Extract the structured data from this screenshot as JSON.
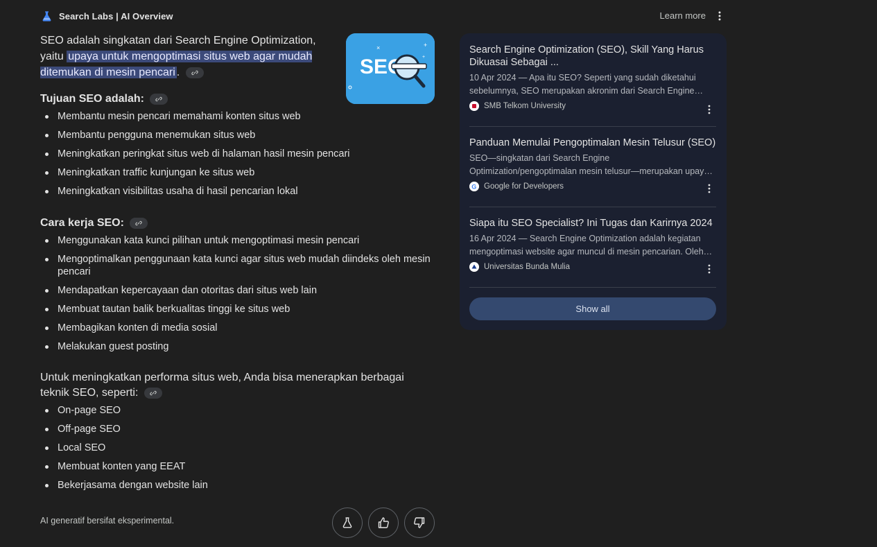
{
  "header": {
    "brand": "Search Labs | AI Overview",
    "learn_more": "Learn more"
  },
  "answer": {
    "intro_prefix": "SEO adalah singkatan dari Search Engine Optimization, yaitu ",
    "intro_highlight": "upaya untuk mengoptimasi situs web agar mudah ditemukan di mesin pencari",
    "intro_suffix": ".",
    "image_text": "SEO",
    "goals": {
      "heading": "Tujuan SEO adalah:",
      "items": [
        "Membantu mesin pencari memahami konten situs web",
        "Membantu pengguna menemukan situs web",
        "Meningkatkan peringkat situs web di halaman hasil mesin pencari",
        "Meningkatkan traffic kunjungan ke situs web",
        "Meningkatkan visibilitas usaha di hasil pencarian lokal"
      ]
    },
    "how": {
      "heading": "Cara kerja SEO:",
      "items": [
        "Menggunakan kata kunci pilihan untuk mengoptimasi mesin pencari",
        "Mengoptimalkan penggunaan kata kunci agar situs web mudah diindeks oleh mesin pencari",
        "Mendapatkan kepercayaan dan otoritas dari situs web lain",
        "Membuat tautan balik berkualitas tinggi ke situs web",
        "Membagikan konten di media sosial",
        "Melakukan guest posting"
      ]
    },
    "techniques": {
      "intro": "Untuk meningkatkan performa situs web, Anda bisa menerapkan berbagai teknik SEO, seperti:",
      "items": [
        "On-page SEO",
        "Off-page SEO",
        "Local SEO",
        "Membuat konten yang EEAT",
        "Bekerjasama dengan website lain"
      ]
    },
    "footer_note": "AI generatif bersifat eksperimental."
  },
  "sources": [
    {
      "title": "Search Engine Optimization (SEO), Skill Yang Harus Dikuasai Sebagai ...",
      "snippet": "10 Apr 2024 — Apa itu SEO? Seperti yang sudah diketahui sebelumnya, SEO merupakan akronim dari Search Engine Optimization...",
      "site": "SMB Telkom University",
      "favicon_color": "#c8102e"
    },
    {
      "title": "Panduan Memulai Pengoptimalan Mesin Telusur (SEO)",
      "snippet": "SEO—singkatan dari Search Engine Optimization/pengoptimalan mesin telusur—merupakan upaya membuat situs...",
      "site": "Google for Developers",
      "favicon_color": "#4285f4"
    },
    {
      "title": "Siapa itu SEO Specialist? Ini Tugas dan Karirnya 2024",
      "snippet": "16 Apr 2024 — Search Engine Optimization adalah kegiatan mengoptimasi website agar muncul di mesin pencarian. Oleh karena itu...",
      "site": "Universitas Bunda Mulia",
      "favicon_color": "#1a3c8c"
    }
  ],
  "show_all": "Show all",
  "colors": {
    "background": "#1f1f1f",
    "card": "#1b2030",
    "highlight": "#3c4a7a",
    "button": "#34496f"
  }
}
